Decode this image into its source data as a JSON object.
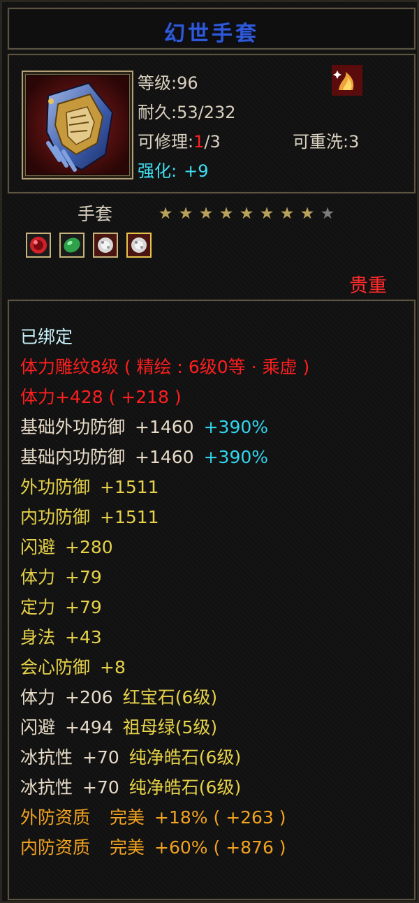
{
  "item": {
    "name": "幻世手套",
    "level_label": "等级:",
    "level": "96",
    "durability_label": "耐久:",
    "durability": "53/232",
    "repairable_label": "可修理:",
    "repairable_used": "1",
    "repairable_total": "/3",
    "rewash_label": "可重洗:",
    "rewash": "3",
    "enhance_label": "强化:",
    "enhance": "+9",
    "type": "手套",
    "stars": {
      "filled": 8,
      "total": 9
    },
    "rarity": "贵重",
    "gems": [
      "ruby-gem-icon",
      "emerald-gem-icon",
      "diamond-gem-icon",
      "diamond-gem-icon"
    ]
  },
  "attributes": [
    {
      "main": "已绑定",
      "color": "bind"
    },
    {
      "main": "体力雕纹8级 ( 精绘 : 6级0等 · 乘虚 )",
      "color": "red"
    },
    {
      "main": "体力+428 ( +218 )",
      "color": "red"
    },
    {
      "main": "基础外功防御",
      "value": "+1460",
      "extra": "+390%",
      "color": "white",
      "extra_color": "cyan"
    },
    {
      "main": "基础内功防御",
      "value": "+1460",
      "extra": "+390%",
      "color": "white",
      "extra_color": "cyan"
    },
    {
      "main": "外功防御",
      "value": "+1511",
      "color": "yellow"
    },
    {
      "main": "内功防御",
      "value": "+1511",
      "color": "yellow"
    },
    {
      "main": "闪避",
      "value": "+280",
      "color": "yellow"
    },
    {
      "main": "体力",
      "value": "+79",
      "color": "yellow"
    },
    {
      "main": "定力",
      "value": "+79",
      "color": "yellow"
    },
    {
      "main": "身法",
      "value": "+43",
      "color": "yellow"
    },
    {
      "main": "会心防御",
      "value": "+8",
      "color": "yellow"
    },
    {
      "main": "体力",
      "value": "+206",
      "extra": "红宝石(6级)",
      "color": "white",
      "extra_color": "yellow"
    },
    {
      "main": "闪避",
      "value": "+494",
      "extra": "祖母绿(5级)",
      "color": "white",
      "extra_color": "yellow"
    },
    {
      "main": "冰抗性",
      "value": "+70",
      "extra": "纯净皓石(6级)",
      "color": "white",
      "extra_color": "yellow"
    },
    {
      "main": "冰抗性",
      "value": "+70",
      "extra": "纯净皓石(6级)",
      "color": "white",
      "extra_color": "yellow"
    },
    {
      "main": "外防资质",
      "value": "完美",
      "extra": "+18% ( +263 )",
      "color": "orange",
      "extra_color": "orange"
    },
    {
      "main": "内防资质",
      "value": "完美",
      "extra": "+60% ( +876 )",
      "color": "orange",
      "extra_color": "orange"
    }
  ],
  "colors": {
    "bind": "#c9f3fb",
    "red": "#ff1f1f",
    "white": "#e8dcc8",
    "cyan": "#32d5ee",
    "yellow": "#e7d24a",
    "orange": "#f2a321",
    "title": "#2f59d6",
    "star_on": "#b9a25c",
    "star_off": "#7c7c7c"
  }
}
